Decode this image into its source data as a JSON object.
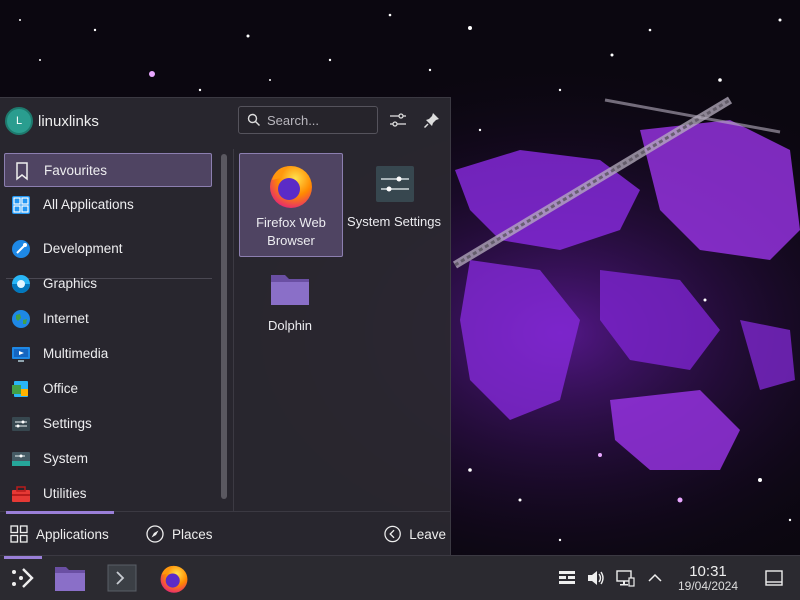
{
  "header": {
    "avatar_letter": "L",
    "username": "linuxlinks",
    "search_placeholder": "Search..."
  },
  "categories": [
    {
      "label": "Favourites",
      "icon": "bookmark-icon",
      "selected": true
    },
    {
      "label": "All Applications",
      "icon": "grid-icon"
    },
    {
      "label": "Development",
      "icon": "development-icon"
    },
    {
      "label": "Graphics",
      "icon": "graphics-icon"
    },
    {
      "label": "Internet",
      "icon": "internet-globe-icon"
    },
    {
      "label": "Multimedia",
      "icon": "multimedia-icon"
    },
    {
      "label": "Office",
      "icon": "office-icon"
    },
    {
      "label": "Settings",
      "icon": "settings-icon"
    },
    {
      "label": "System",
      "icon": "system-icon"
    },
    {
      "label": "Utilities",
      "icon": "utilities-toolbox-icon"
    }
  ],
  "apps": [
    {
      "label": "Firefox Web Browser",
      "icon": "firefox-icon",
      "selected": true
    },
    {
      "label": "System Settings",
      "icon": "system-settings-icon"
    },
    {
      "label": "Dolphin",
      "icon": "dolphin-folder-icon"
    }
  ],
  "footer": {
    "applications_label": "Applications",
    "places_label": "Places",
    "leave_label": "Leave"
  },
  "taskbar": {
    "items": [
      "application-launcher-icon",
      "dolphin-folder-icon",
      "konsole-terminal-icon",
      "firefox-icon"
    ],
    "tray": [
      "clipboard-icon",
      "volume-icon",
      "network-icon",
      "chevron-up-icon"
    ],
    "time": "10:31",
    "date": "19/04/2024",
    "show_desktop": "show-desktop-icon"
  },
  "colors": {
    "accent": "#9a7fd8",
    "selection_bg": "#4f4462",
    "panel_bg": "#2a2830",
    "wallpaper_purple": "#8a2be2"
  }
}
